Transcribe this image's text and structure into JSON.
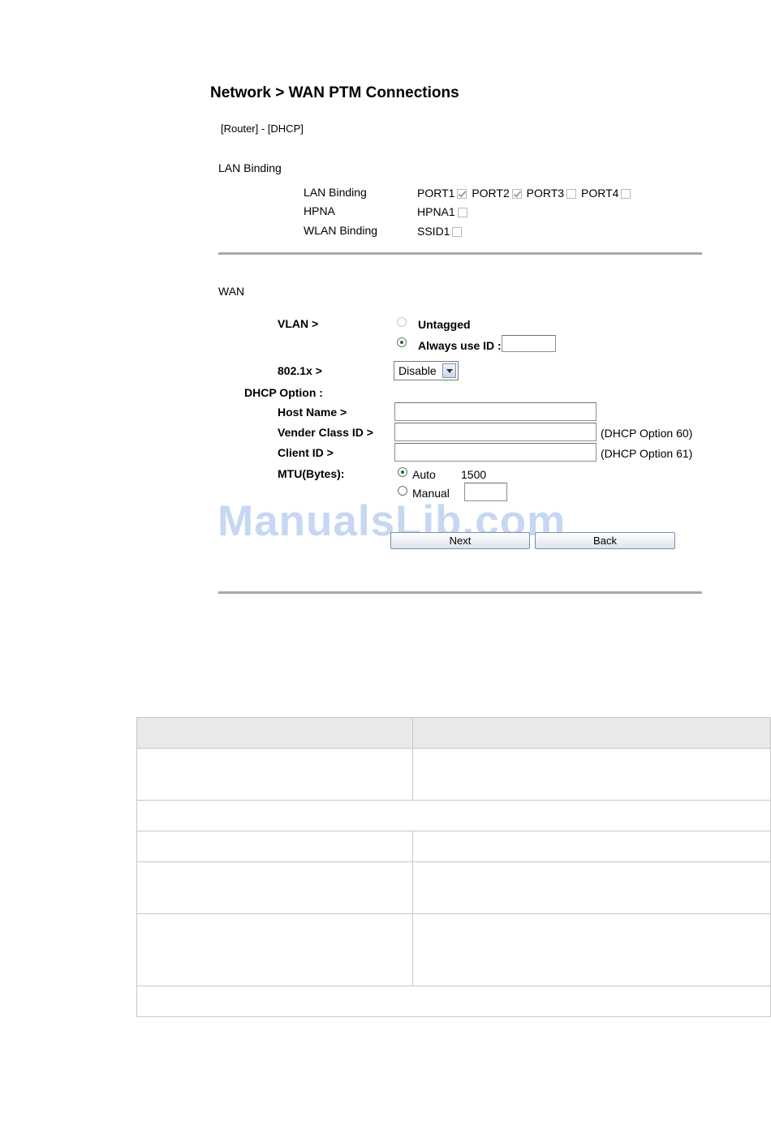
{
  "page": {
    "title": "Network > WAN PTM Connections",
    "subtitle": "[Router] - [DHCP]"
  },
  "lan_binding": {
    "section_label": "LAN Binding",
    "rows": [
      {
        "label": "LAN Binding"
      },
      {
        "label": "HPNA"
      },
      {
        "label": "WLAN Binding"
      }
    ],
    "ports": [
      {
        "label": "PORT1",
        "checked": true
      },
      {
        "label": "PORT2",
        "checked": true
      },
      {
        "label": "PORT3",
        "checked": false
      },
      {
        "label": "PORT4",
        "checked": false
      }
    ],
    "hpna": {
      "label": "HPNA1",
      "checked": false
    },
    "wlan": {
      "label": "SSID1",
      "checked": false
    }
  },
  "wan": {
    "section_label": "WAN",
    "vlan": {
      "label": "VLAN >",
      "untagged": "Untagged",
      "always": "Always use ID :",
      "selected": "always",
      "id_value": ""
    },
    "dot1x": {
      "label": "802.1x >",
      "value": "Disable"
    },
    "dhcp_option": {
      "label": "DHCP Option :",
      "host_name": {
        "label": "Host Name >",
        "value": ""
      },
      "vender_class": {
        "label": "Vender Class ID >",
        "value": "",
        "note": "(DHCP Option 60)"
      },
      "client_id": {
        "label": "Client ID >",
        "value": "",
        "note": "(DHCP Option 61)"
      }
    },
    "mtu": {
      "label": "MTU(Bytes):",
      "auto": "Auto",
      "auto_value": "1500",
      "manual": "Manual",
      "manual_value": "",
      "selected": "auto"
    }
  },
  "buttons": {
    "next": "Next",
    "back": "Back"
  },
  "watermark": "ManualsLib.com"
}
